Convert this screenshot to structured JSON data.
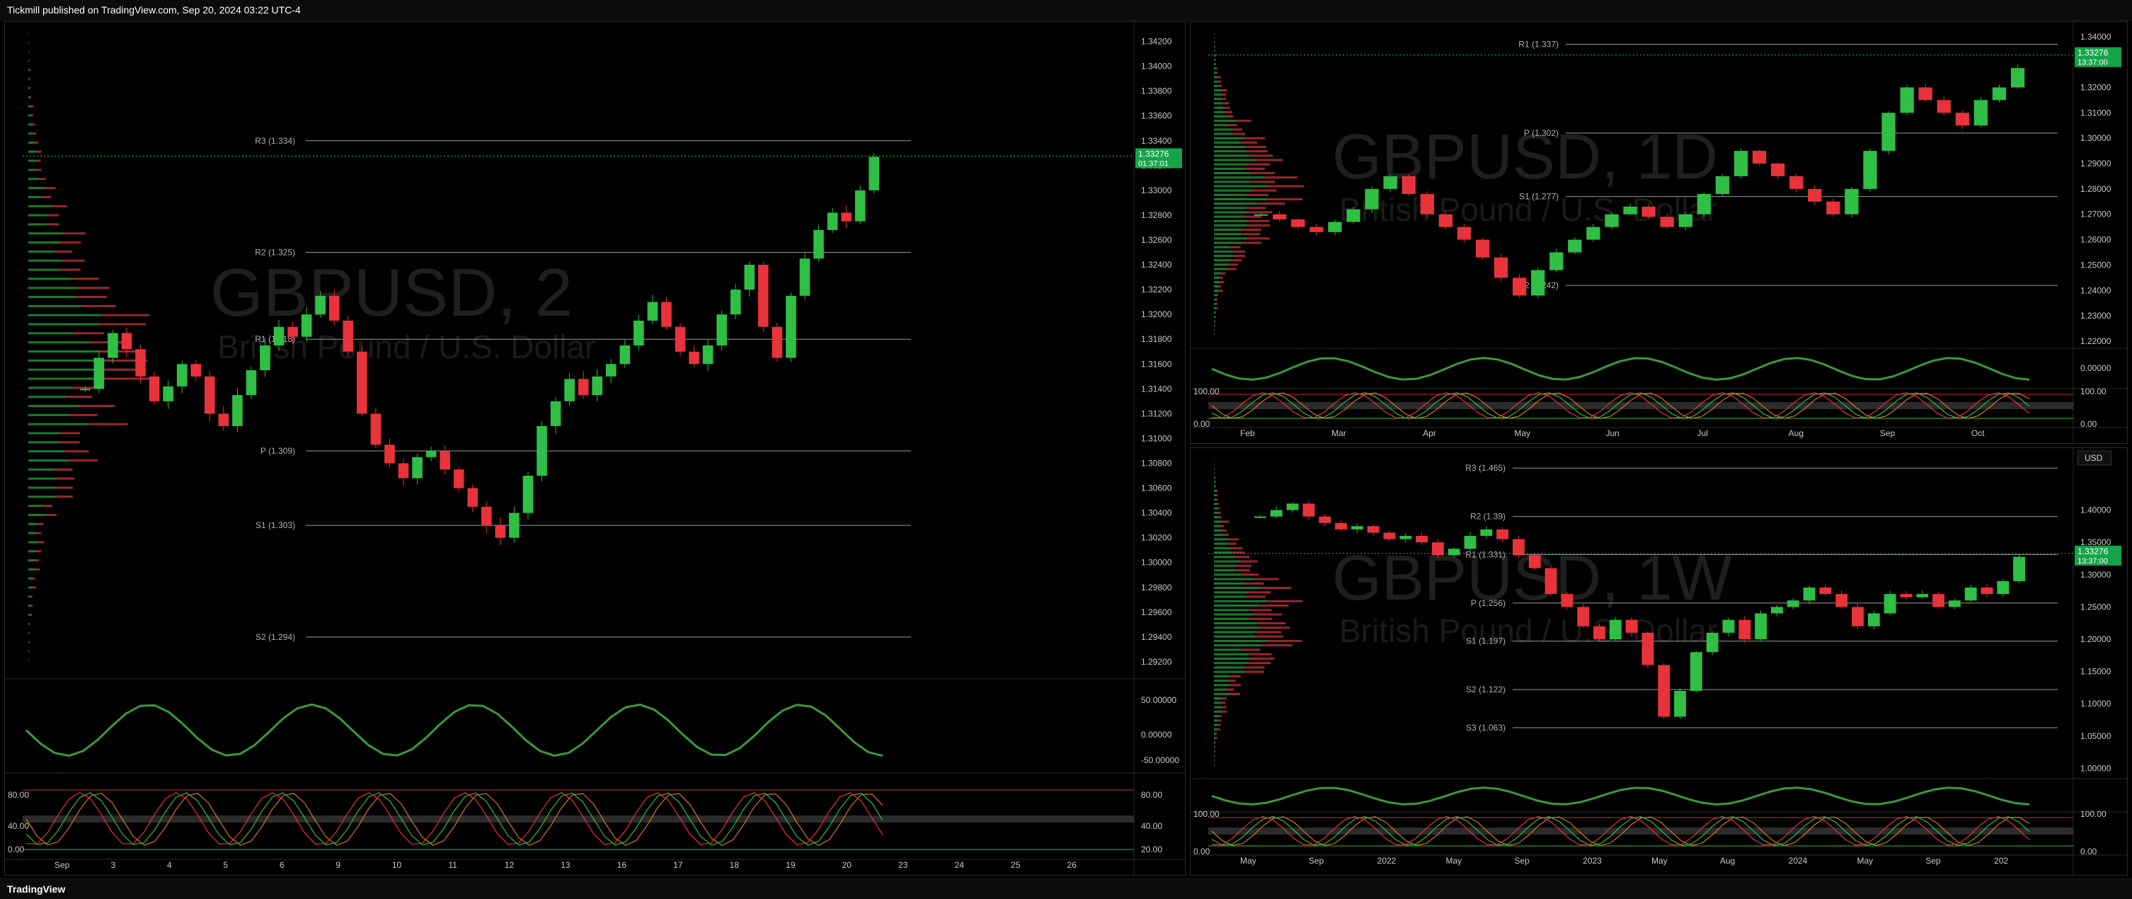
{
  "header": {
    "published": "Tickmill published on TradingView.com, Sep 20, 2024 03:22 UTC-4"
  },
  "footer": {
    "brand": "TradingView"
  },
  "charts": [
    {
      "id": "main",
      "watermark_symbol": "GBPUSD, 2",
      "watermark_name": "British Pound / U.S. Dollar",
      "price_axis": [
        "1.34200",
        "1.34000",
        "1.33800",
        "1.33600",
        "1.33400",
        "1.33200",
        "1.33000",
        "1.32800",
        "1.32600",
        "1.32400",
        "1.32200",
        "1.32000",
        "1.31800",
        "1.31600",
        "1.31400",
        "1.31200",
        "1.31000",
        "1.30800",
        "1.30600",
        "1.30400",
        "1.30200",
        "1.30000",
        "1.29800",
        "1.29600",
        "1.29400",
        "1.29200"
      ],
      "price_min": 1.2912,
      "price_max": 1.343,
      "last_price": "1.33276",
      "countdown": "01:37:01",
      "pivots": [
        {
          "label": "R3 (1.334)",
          "value": 1.334
        },
        {
          "label": "R2 (1.325)",
          "value": 1.325
        },
        {
          "label": "R1 (1.318)",
          "value": 1.318
        },
        {
          "label": "P (1.309)",
          "value": 1.309
        },
        {
          "label": "S1 (1.303)",
          "value": 1.303
        },
        {
          "label": "S2 (1.294)",
          "value": 1.294
        }
      ],
      "time_axis": [
        "Sep",
        "3",
        "4",
        "5",
        "6",
        "9",
        "10",
        "11",
        "12",
        "13",
        "16",
        "17",
        "18",
        "19",
        "20",
        "23",
        "24",
        "25",
        "26"
      ],
      "osc1_axis": [
        "50.00000",
        "0.00000",
        "-50.00000"
      ],
      "osc2_axis": [
        "80.00",
        "40.00",
        "0.00"
      ],
      "osc2_right": [
        "80.00",
        "40.00",
        "20.00"
      ],
      "candles": [
        1.314,
        1.3165,
        1.3185,
        1.3172,
        1.315,
        1.313,
        1.3142,
        1.316,
        1.315,
        1.312,
        1.311,
        1.3135,
        1.3155,
        1.3175,
        1.319,
        1.3182,
        1.32,
        1.3215,
        1.3195,
        1.317,
        1.312,
        1.3095,
        1.308,
        1.3068,
        1.3085,
        1.309,
        1.3075,
        1.306,
        1.3045,
        1.303,
        1.302,
        1.304,
        1.307,
        1.311,
        1.313,
        1.3148,
        1.3135,
        1.315,
        1.316,
        1.3175,
        1.3195,
        1.321,
        1.319,
        1.317,
        1.316,
        1.3175,
        1.32,
        1.322,
        1.324,
        1.319,
        1.3165,
        1.3215,
        1.3245,
        1.3268,
        1.3282,
        1.3275,
        1.33,
        1.3327
      ]
    },
    {
      "id": "daily",
      "watermark_symbol": "GBPUSD, 1D",
      "watermark_name": "British Pound / U.S. Dollar",
      "price_axis": [
        "1.34000",
        "1.33000",
        "1.32000",
        "1.31000",
        "1.30000",
        "1.29000",
        "1.28000",
        "1.27000",
        "1.26000",
        "1.25000",
        "1.24000",
        "1.23000",
        "1.22000"
      ],
      "price_min": 1.22,
      "price_max": 1.343,
      "last_price": "1.33276",
      "countdown": "13:37:00",
      "pivots": [
        {
          "label": "R1 (1.337)",
          "value": 1.337
        },
        {
          "label": "P (1.302)",
          "value": 1.302
        },
        {
          "label": "S1 (1.277)",
          "value": 1.277
        },
        {
          "label": "S2 (1.242)",
          "value": 1.242
        }
      ],
      "time_axis": [
        "Feb",
        "Mar",
        "Apr",
        "May",
        "Jun",
        "Jul",
        "Aug",
        "Sep",
        "Oct"
      ],
      "osc1_axis": [
        "0.00000"
      ],
      "osc2_axis": [
        "100.00",
        "0.00"
      ],
      "osc2_right": [
        "100.00",
        "0.00"
      ],
      "candles": [
        1.27,
        1.268,
        1.265,
        1.263,
        1.267,
        1.272,
        1.28,
        1.285,
        1.278,
        1.27,
        1.265,
        1.26,
        1.253,
        1.245,
        1.238,
        1.248,
        1.255,
        1.26,
        1.265,
        1.27,
        1.273,
        1.269,
        1.265,
        1.27,
        1.278,
        1.285,
        1.295,
        1.29,
        1.285,
        1.28,
        1.275,
        1.27,
        1.28,
        1.295,
        1.31,
        1.32,
        1.315,
        1.31,
        1.305,
        1.315,
        1.32,
        1.3276
      ]
    },
    {
      "id": "weekly",
      "watermark_symbol": "GBPUSD, 1W",
      "watermark_name": "British Pound / U.S. Dollar",
      "price_axis": [
        "1.40000",
        "1.35000",
        "1.30000",
        "1.25000",
        "1.20000",
        "1.15000",
        "1.10000",
        "1.05000",
        "1.00000"
      ],
      "price_min": 0.995,
      "price_max": 1.485,
      "last_price": "1.33276",
      "countdown": "13:37:00",
      "currency": "USD",
      "pivots": [
        {
          "label": "R3 (1.465)",
          "value": 1.465
        },
        {
          "label": "R2 (1.39)",
          "value": 1.39
        },
        {
          "label": "R1 (1.331)",
          "value": 1.331
        },
        {
          "label": "P (1.256)",
          "value": 1.256
        },
        {
          "label": "S1 (1.197)",
          "value": 1.197
        },
        {
          "label": "S2 (1.122)",
          "value": 1.122
        },
        {
          "label": "S3 (1.063)",
          "value": 1.063
        }
      ],
      "time_axis": [
        "May",
        "Sep",
        "2022",
        "May",
        "Sep",
        "2023",
        "May",
        "Aug",
        "2024",
        "May",
        "Sep",
        "202"
      ],
      "osc1_axis": [],
      "osc2_axis": [
        "100.00",
        "0.00"
      ],
      "osc2_right": [
        "100.00",
        "0.00"
      ],
      "candles": [
        1.39,
        1.4,
        1.41,
        1.39,
        1.38,
        1.37,
        1.375,
        1.365,
        1.355,
        1.36,
        1.35,
        1.33,
        1.34,
        1.36,
        1.37,
        1.355,
        1.33,
        1.31,
        1.27,
        1.25,
        1.22,
        1.2,
        1.23,
        1.21,
        1.16,
        1.08,
        1.12,
        1.18,
        1.21,
        1.23,
        1.2,
        1.24,
        1.25,
        1.26,
        1.28,
        1.27,
        1.25,
        1.22,
        1.24,
        1.27,
        1.265,
        1.27,
        1.25,
        1.26,
        1.28,
        1.27,
        1.29,
        1.3276
      ]
    }
  ]
}
